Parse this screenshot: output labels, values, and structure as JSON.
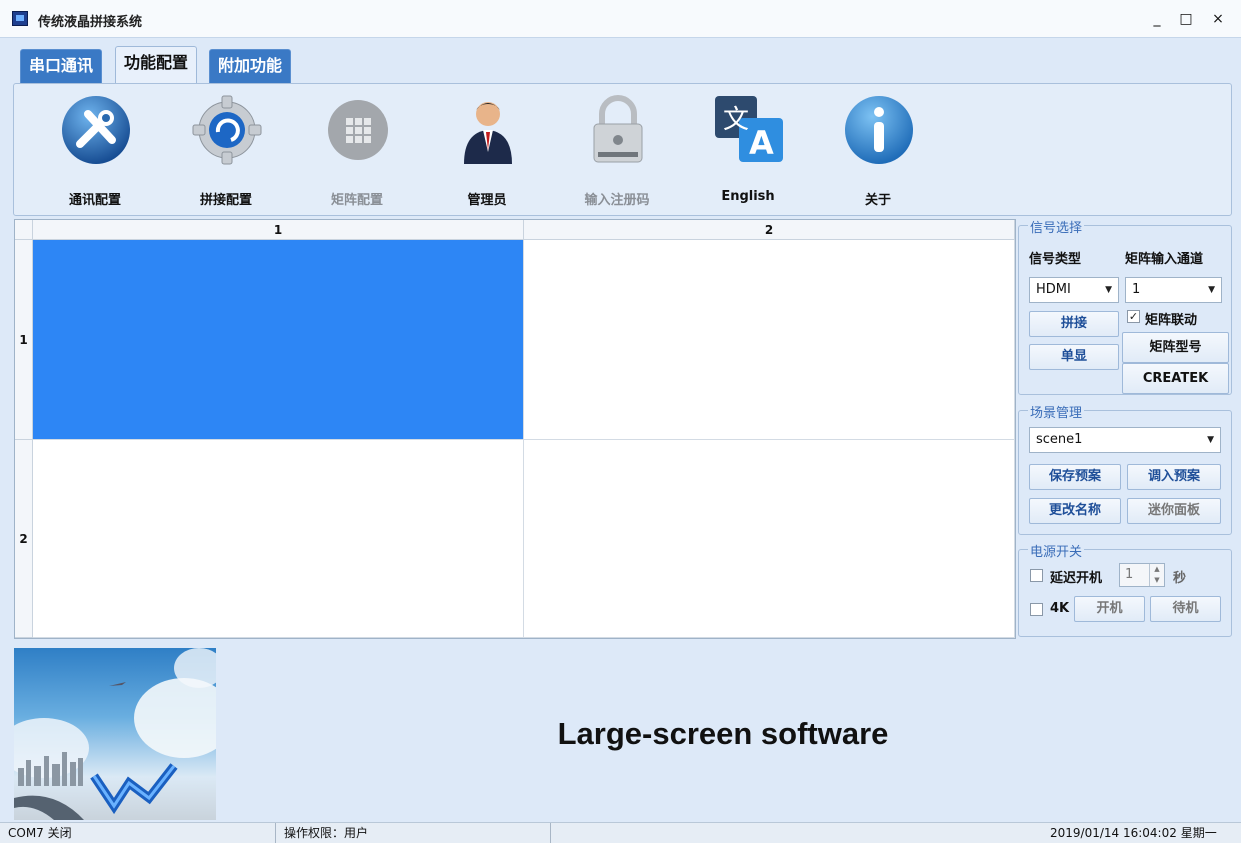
{
  "window": {
    "title": "传统液晶拼接系统",
    "controls": {
      "minimize": "_",
      "maximize": "□",
      "close": "×"
    }
  },
  "tabs": [
    {
      "label": "串口通讯",
      "active": false
    },
    {
      "label": "功能配置",
      "active": true
    },
    {
      "label": "附加功能",
      "active": false
    }
  ],
  "toolbar": [
    {
      "label": "通讯配置",
      "icon": "tools-icon",
      "enabled": true
    },
    {
      "label": "拼接配置",
      "icon": "gear-refresh-icon",
      "enabled": true
    },
    {
      "label": "矩阵配置",
      "icon": "grid-icon",
      "enabled": false
    },
    {
      "label": "管理员",
      "icon": "admin-person-icon",
      "enabled": true
    },
    {
      "label": "输入注册码",
      "icon": "padlock-icon",
      "enabled": false
    },
    {
      "label": "English",
      "icon": "translate-icon",
      "enabled": true
    },
    {
      "label": "关于",
      "icon": "info-icon",
      "enabled": true
    }
  ],
  "grid": {
    "col_headers": [
      "1",
      "2"
    ],
    "row_headers": [
      "1",
      "2"
    ],
    "selected_cell": "r1c1"
  },
  "signal": {
    "group_title": "信号选择",
    "type_label": "信号类型",
    "channel_label": "矩阵输入通道",
    "type_value": "HDMI",
    "channel_value": "1",
    "splice_button": "拼接",
    "single_button": "单显",
    "matrix_link_label": "矩阵联动",
    "matrix_link_checked": true,
    "matrix_model_label": "矩阵型号",
    "matrix_model_value": "CREATEK"
  },
  "scene": {
    "group_title": "场景管理",
    "selected": "scene1",
    "save_button": "保存预案",
    "load_button": "调入预案",
    "rename_button": "更改名称",
    "mini_panel_button": "迷你面板"
  },
  "power": {
    "group_title": "电源开关",
    "delay_label": "延迟开机",
    "delay_checked": false,
    "delay_value": "1",
    "delay_unit": "秒",
    "fourk_label": "4K",
    "fourk_checked": false,
    "on_button": "开机",
    "standby_button": "待机"
  },
  "banner": {
    "text": "Large-screen software"
  },
  "status": {
    "port": "COM7 关闭",
    "permission": "操作权限：用户",
    "datetime": "2019/01/14 16:04:02 星期一"
  },
  "colors": {
    "selected_cell": "#2d86f5",
    "tab_bg": "#3a79c5",
    "accent_text": "#1f4f99"
  }
}
